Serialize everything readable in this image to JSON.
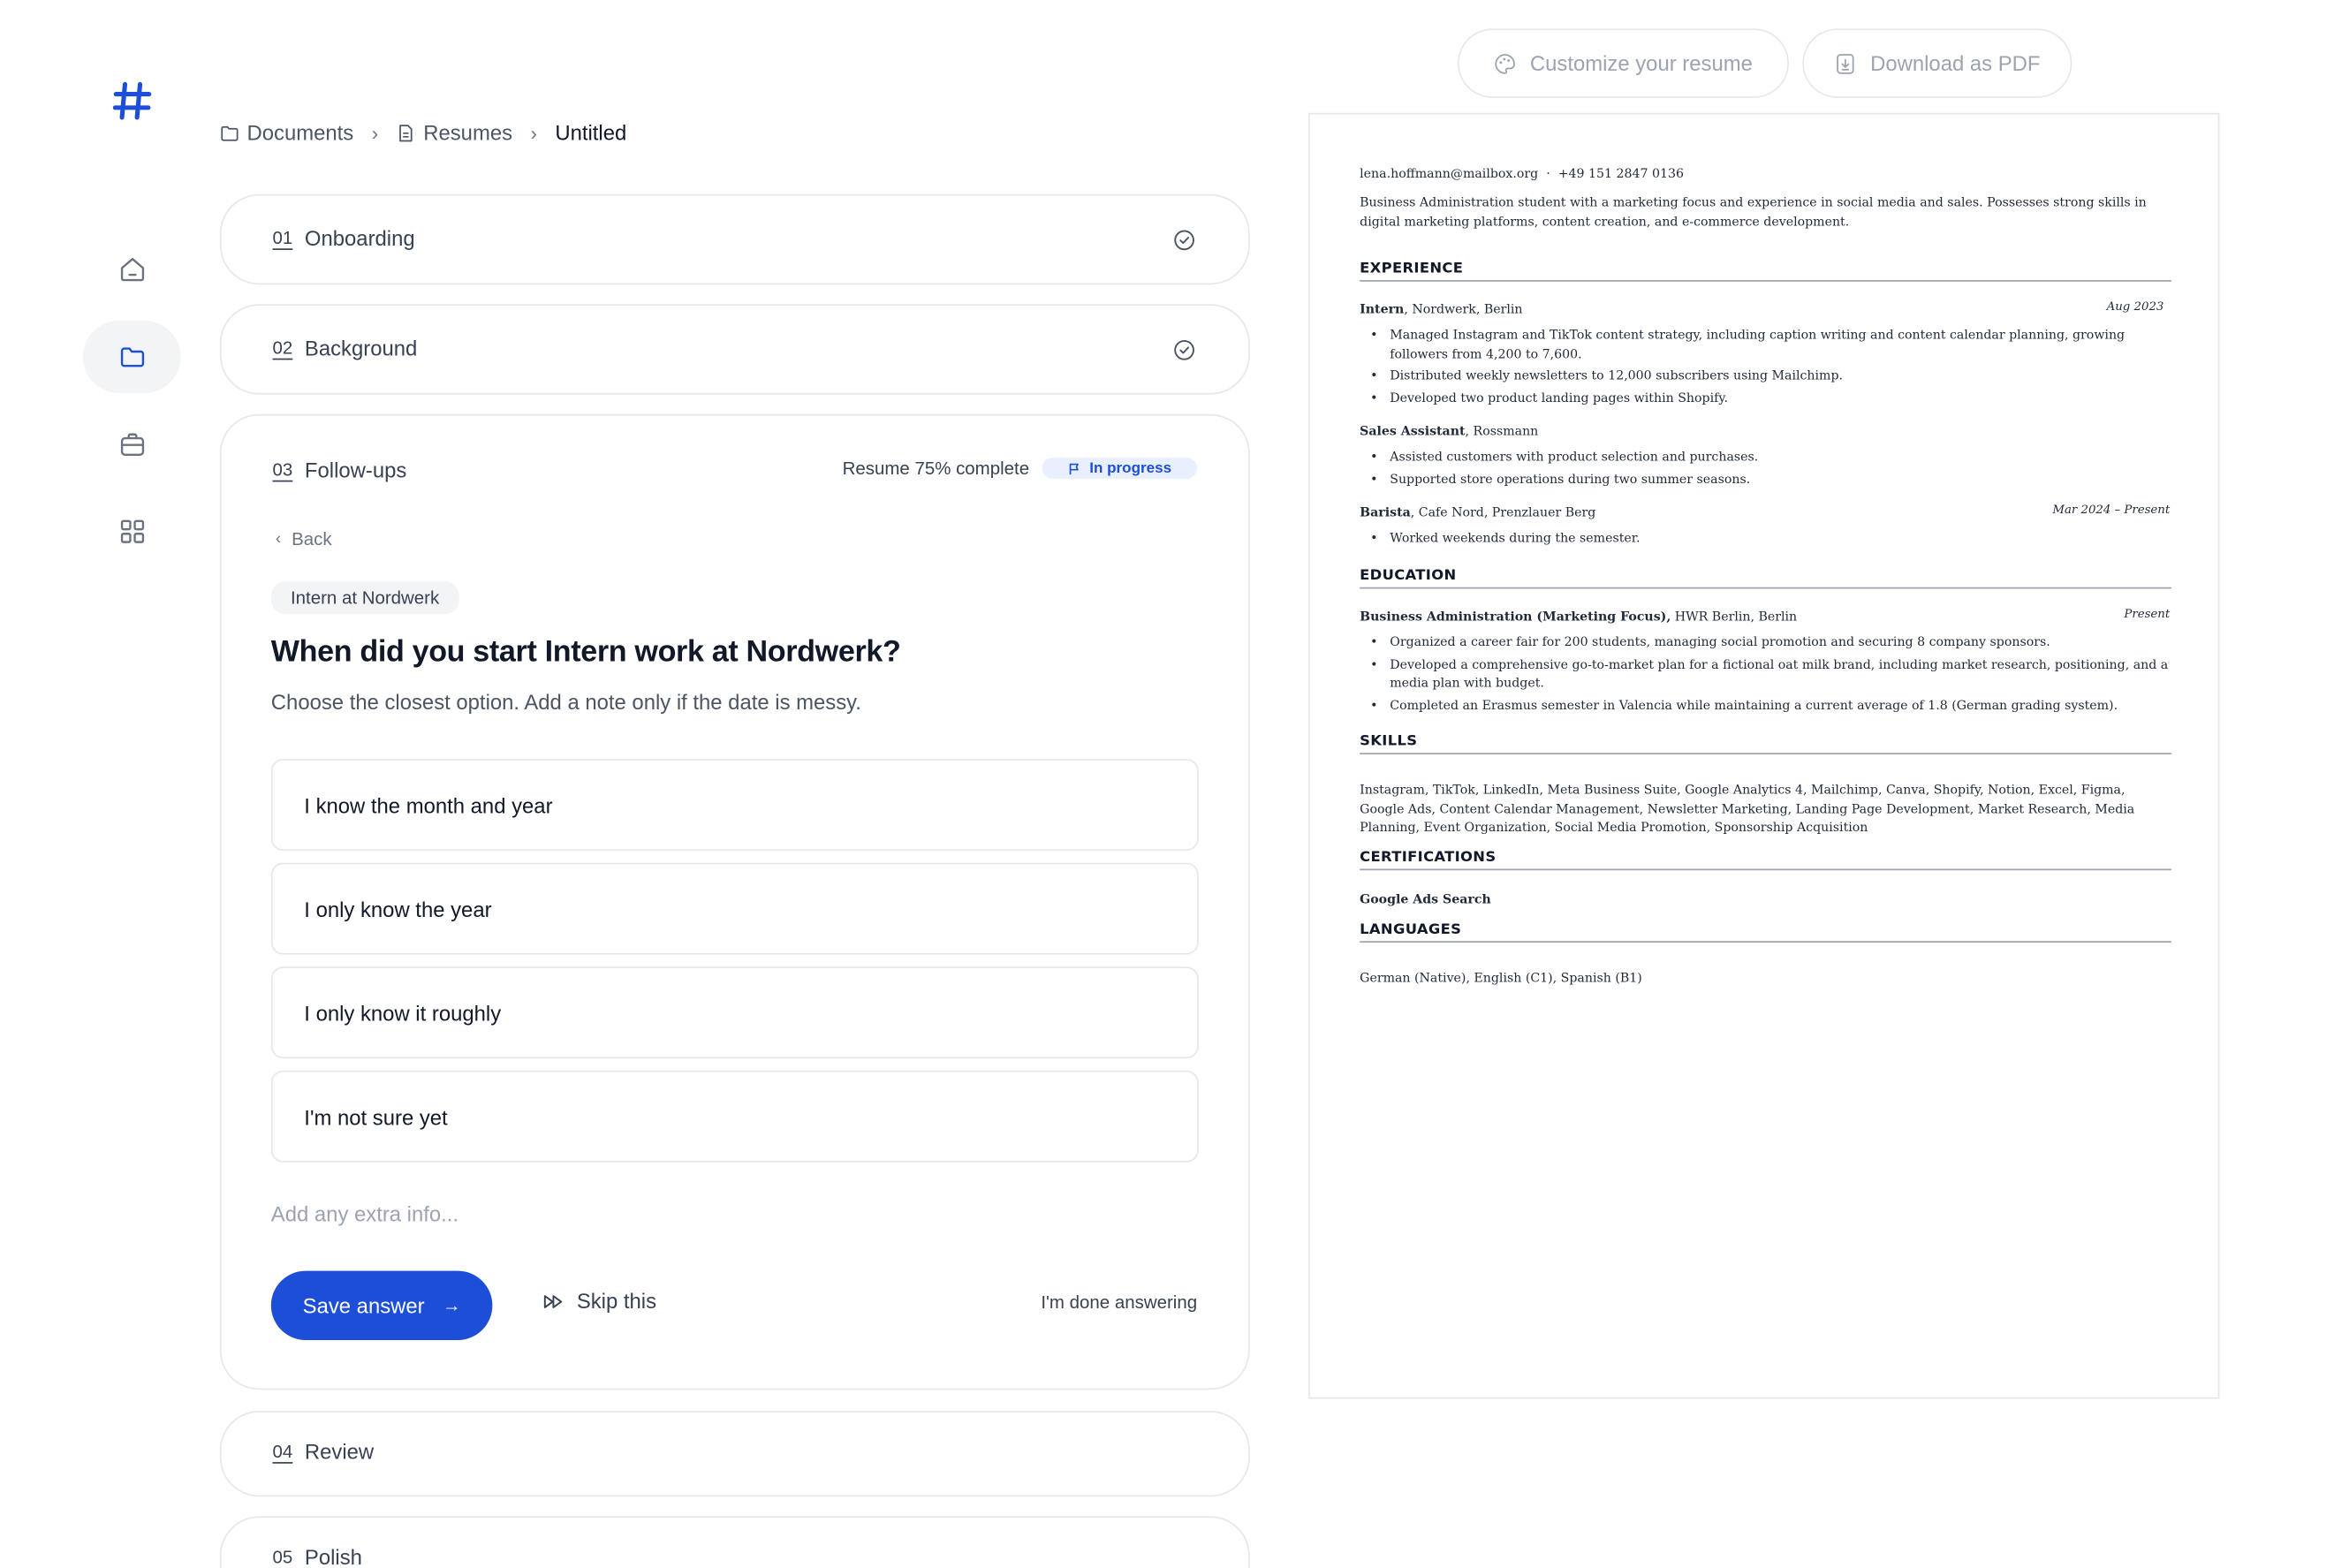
{
  "breadcrumb": [
    "Documents",
    "Resumes",
    "Untitled"
  ],
  "steps": [
    {
      "num": "01",
      "label": "Onboarding"
    },
    {
      "num": "02",
      "label": "Background"
    },
    {
      "num": "03",
      "label": "Follow-ups"
    },
    {
      "num": "04",
      "label": "Review"
    },
    {
      "num": "05",
      "label": "Polish"
    }
  ],
  "followup": {
    "progress_text": "Resume 75% complete",
    "progress_percent": 75,
    "status_badge": "In progress",
    "back_label": "Back",
    "chip": "Intern at Nordwerk",
    "question": "When did you start Intern work at Nordwerk?",
    "subtitle": "Choose the closest option. Add a note only if the date is messy.",
    "options": [
      "I know the month and year",
      "I only know the year",
      "I only know it roughly",
      "I'm not sure yet"
    ],
    "extra_placeholder": "Add any extra info...",
    "save_label": "Save answer",
    "skip_label": "Skip this",
    "done_label": "I'm done answering"
  },
  "toolbar": {
    "customize_label": "Customize your resume",
    "download_label": "Download as PDF"
  },
  "resume": {
    "email": "lena.hoffmann@mailbox.org",
    "phone": "+49 151 2847 0136",
    "summary": "Business Administration student with a marketing focus and experience in social media and sales. Possesses strong skills in digital marketing platforms, content creation, and e-commerce development.",
    "sections": {
      "experience": "EXPERIENCE",
      "education": "EDUCATION",
      "skills": "SKILLS",
      "certifications": "CERTIFICATIONS",
      "languages": "LANGUAGES"
    },
    "jobs": [
      {
        "title": "Intern",
        "org": ", Nordwerk, Berlin",
        "date": "Aug 2023",
        "bullets": [
          "Managed Instagram and TikTok content strategy, including caption writing and content calendar planning, growing followers from 4,200 to 7,600.",
          "Distributed weekly newsletters to 12,000 subscribers using Mailchimp.",
          "Developed two product landing pages within Shopify."
        ]
      },
      {
        "title": "Sales Assistant",
        "org": ", Rossmann",
        "date": "",
        "bullets": [
          "Assisted customers with product selection and purchases.",
          "Supported store operations during two summer seasons."
        ]
      },
      {
        "title": "Barista",
        "org": ", Cafe Nord, Prenzlauer Berg",
        "date": "Mar 2024 – Present",
        "bullets": [
          "Worked weekends during the semester."
        ]
      }
    ],
    "education": {
      "degree": "Business Administration (Marketing Focus),",
      "school": " HWR Berlin, Berlin",
      "date": "Present",
      "bullets": [
        "Organized a career fair for 200 students, managing social promotion and securing 8 company sponsors.",
        "Developed a comprehensive go-to-market plan for a fictional oat milk brand, including market research, positioning, and a media plan with budget.",
        "Completed an Erasmus semester in Valencia while maintaining a current average of 1.8 (German grading system)."
      ]
    },
    "skills": "Instagram, TikTok, LinkedIn, Meta Business Suite, Google Analytics 4, Mailchimp, Canva, Shopify, Notion, Excel, Figma, Google Ads, Content Calendar Management, Newsletter Marketing, Landing Page Development, Market Research, Media Planning, Event Organization, Social Media Promotion, Sponsorship Acquisition",
    "certification": "Google Ads Search",
    "languages": "German (Native), English (C1), Spanish (B1)"
  }
}
